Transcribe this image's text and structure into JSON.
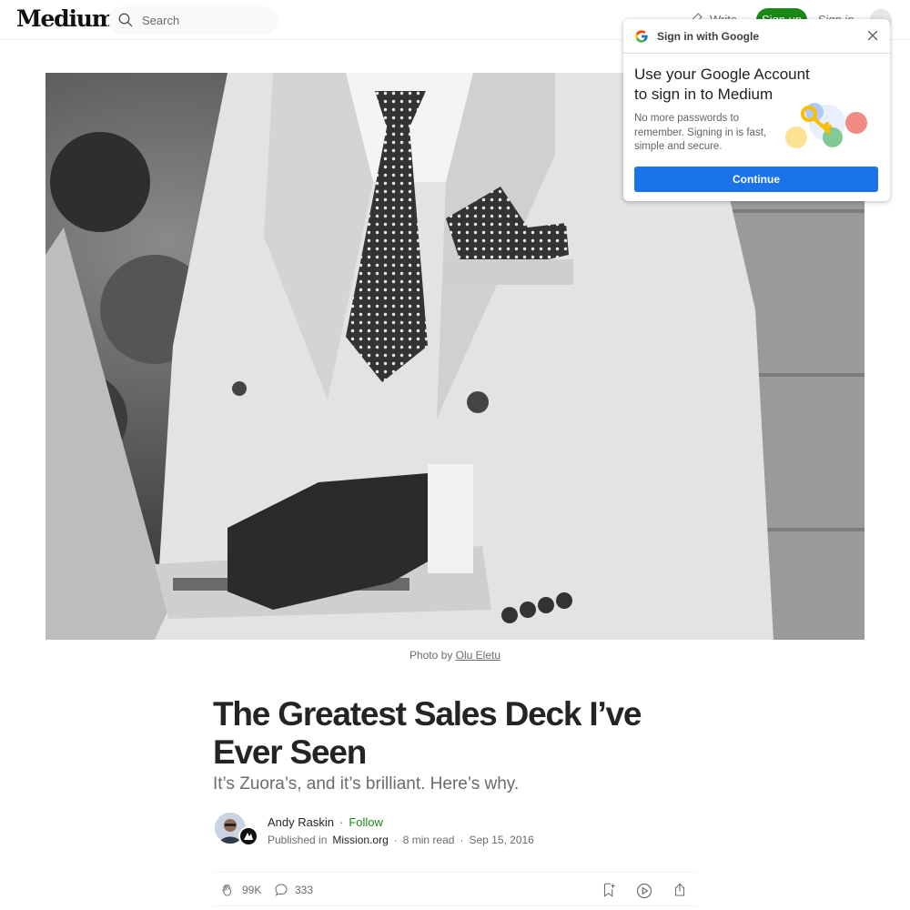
{
  "header": {
    "logo": "Medium",
    "search_placeholder": "Search",
    "write_label": "Write",
    "signup_label": "Sign up",
    "signin_label": "Sign in"
  },
  "hero": {
    "caption_prefix": "Photo by",
    "caption_credit": "Olu Eletu"
  },
  "article": {
    "title": "The Greatest Sales Deck I’ve Ever Seen",
    "subtitle": "It’s Zuora’s, and it’s brilliant. Here’s why.",
    "author": "Andy Raskin",
    "follow_label": "Follow",
    "published_in_prefix": "Published in",
    "publication": "Mission.org",
    "read_time": "8 min read",
    "date": "Sep 15, 2016",
    "separator": "·"
  },
  "actions": {
    "claps": "99K",
    "responses": "333"
  },
  "google_popup": {
    "title": "Sign in with Google",
    "headline": "Use your Google Account to sign in to Medium",
    "body": "No more passwords to remember. Signing in is fast, simple and secure.",
    "continue_label": "Continue"
  },
  "colors": {
    "accent_green": "#1a8917",
    "google_blue": "#1a73e8",
    "text_primary": "#242424",
    "text_secondary": "#6b6b6b"
  }
}
